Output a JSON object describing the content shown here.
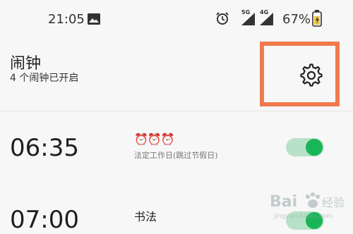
{
  "status_bar": {
    "time": "21:05",
    "battery_percent": "67%",
    "network_labels": [
      "5G",
      "4G"
    ],
    "icons": [
      "gallery-icon",
      "alarm-icon",
      "signal-icon",
      "battery-icon"
    ]
  },
  "header": {
    "title": "闹钟",
    "subtitle": "4 个闹钟已开启",
    "settings_icon": "gear-icon",
    "highlight_color": "#f07a4c"
  },
  "alarms": [
    {
      "time": "06:35",
      "icons": "⏰⏰⏰",
      "description": "法定工作日(跳过节假日)",
      "enabled": true
    },
    {
      "time": "07:00",
      "label": "书法",
      "enabled": true
    }
  ],
  "colors": {
    "toggle_on": "#1ab558",
    "toggle_track": "#b7e2c7"
  },
  "watermark": {
    "text": "Bai 经验",
    "url_text": "jingyan.baidu.com"
  }
}
